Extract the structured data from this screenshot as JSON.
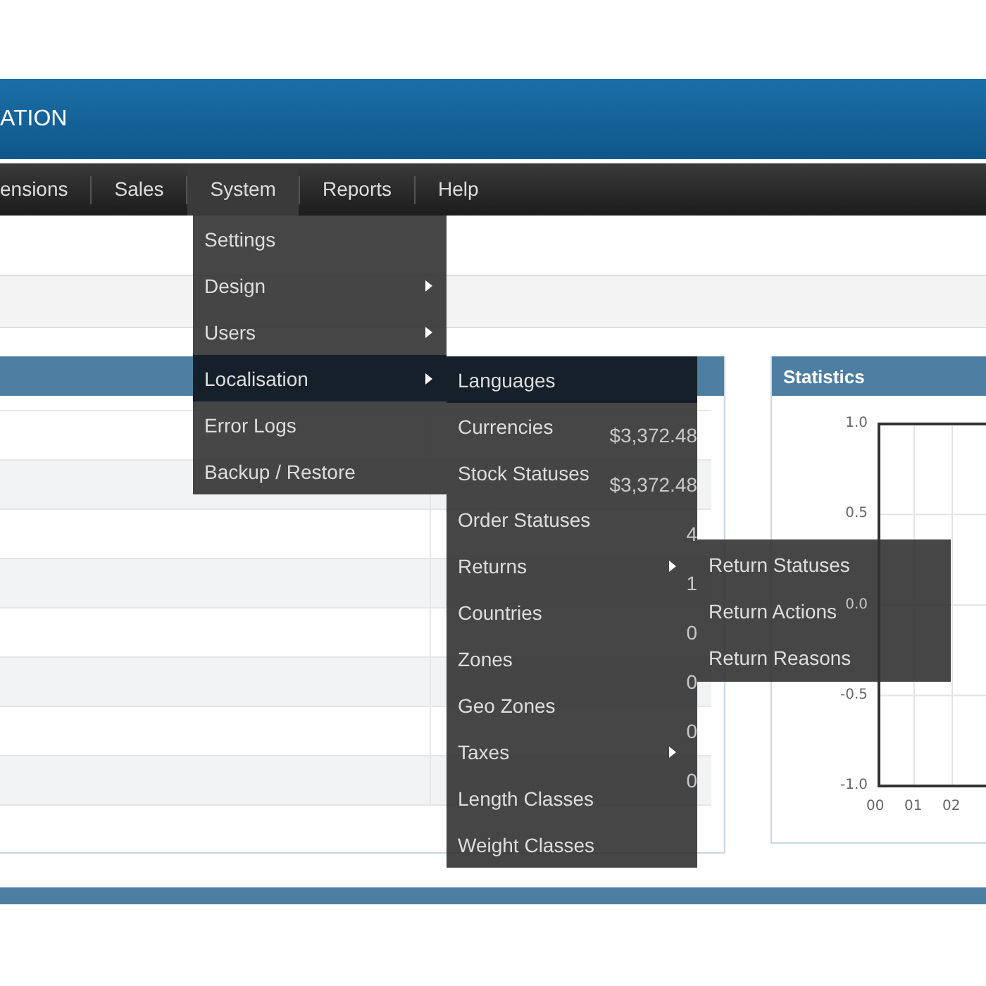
{
  "header": {
    "title": "ATION"
  },
  "nav": [
    {
      "label": "ensions",
      "selected": false
    },
    {
      "label": "Sales",
      "selected": false
    },
    {
      "label": "System",
      "selected": true
    },
    {
      "label": "Reports",
      "selected": false
    },
    {
      "label": "Help",
      "selected": false
    }
  ],
  "system_menu": [
    {
      "label": "Settings",
      "submenu": false,
      "selected": false
    },
    {
      "label": "Design",
      "submenu": true,
      "selected": false
    },
    {
      "label": "Users",
      "submenu": true,
      "selected": false
    },
    {
      "label": "Localisation",
      "submenu": true,
      "selected": true
    },
    {
      "label": "Error Logs",
      "submenu": false,
      "selected": false
    },
    {
      "label": "Backup / Restore",
      "submenu": false,
      "selected": false
    }
  ],
  "localisation_menu": [
    {
      "label": "Languages",
      "submenu": false,
      "selected": true
    },
    {
      "label": "Currencies",
      "submenu": false,
      "selected": false
    },
    {
      "label": "Stock Statuses",
      "submenu": false,
      "selected": false
    },
    {
      "label": "Order Statuses",
      "submenu": false,
      "selected": false
    },
    {
      "label": "Returns",
      "submenu": true,
      "selected": false
    },
    {
      "label": "Countries",
      "submenu": false,
      "selected": false
    },
    {
      "label": "Zones",
      "submenu": false,
      "selected": false
    },
    {
      "label": "Geo Zones",
      "submenu": false,
      "selected": false
    },
    {
      "label": "Taxes",
      "submenu": true,
      "selected": false
    },
    {
      "label": "Length Classes",
      "submenu": false,
      "selected": false
    },
    {
      "label": "Weight Classes",
      "submenu": false,
      "selected": false
    }
  ],
  "returns_menu": [
    {
      "label": "Return Statuses",
      "selected": false
    },
    {
      "label": "Return Actions",
      "selected": false
    },
    {
      "label": "Return Reasons",
      "selected": false
    }
  ],
  "overview": {
    "rows": [
      {
        "value": "$3,372.48"
      },
      {
        "value": "$3,372.48"
      },
      {
        "value": "4"
      },
      {
        "value": "1"
      },
      {
        "value": "0"
      },
      {
        "value": "0"
      },
      {
        "value": "0"
      },
      {
        "value": "0"
      }
    ]
  },
  "statistics": {
    "title": "Statistics",
    "y_ticks": [
      "1.0",
      "0.5",
      "0.0",
      "-0.5",
      "-1.0"
    ],
    "x_ticks": [
      "00",
      "01",
      "02"
    ]
  }
}
